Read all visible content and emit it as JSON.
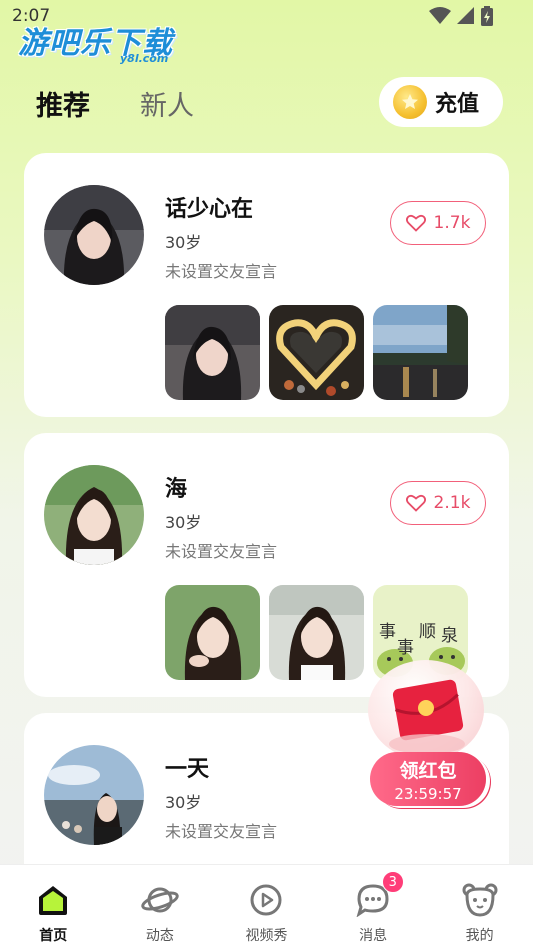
{
  "status_bar": {
    "time": "2:07"
  },
  "watermark": {
    "main": "游吧乐下载",
    "sub": "y8l.com"
  },
  "tabs": [
    {
      "label": "推荐",
      "active": true
    },
    {
      "label": "新人",
      "active": false
    }
  ],
  "recharge": {
    "label": "充值"
  },
  "users": [
    {
      "name": "话少心在",
      "age": "30岁",
      "motto": "未设置交友宣言",
      "likes": "1.7k"
    },
    {
      "name": "海",
      "age": "30岁",
      "motto": "未设置交友宣言",
      "likes": "2.1k"
    },
    {
      "name": "一天",
      "age": "30岁",
      "motto": "未设置交友宣言",
      "likes": ""
    }
  ],
  "sticker_text": [
    "事",
    "顺",
    "事",
    "泉"
  ],
  "red_packet": {
    "title": "领红包",
    "timer": "23:59:57"
  },
  "nav": [
    {
      "label": "首页",
      "icon": "home-icon",
      "active": true
    },
    {
      "label": "动态",
      "icon": "planet-icon",
      "active": false
    },
    {
      "label": "视频秀",
      "icon": "video-play-icon",
      "active": false
    },
    {
      "label": "消息",
      "icon": "chat-icon",
      "active": false,
      "badge": "3"
    },
    {
      "label": "我的",
      "icon": "bear-face-icon",
      "active": false
    }
  ],
  "colors": {
    "accent_pink": "#ec3f63",
    "like_red": "#e74c68",
    "bg_green": "#e2f7a6",
    "badge_pink": "#ff3d78"
  }
}
